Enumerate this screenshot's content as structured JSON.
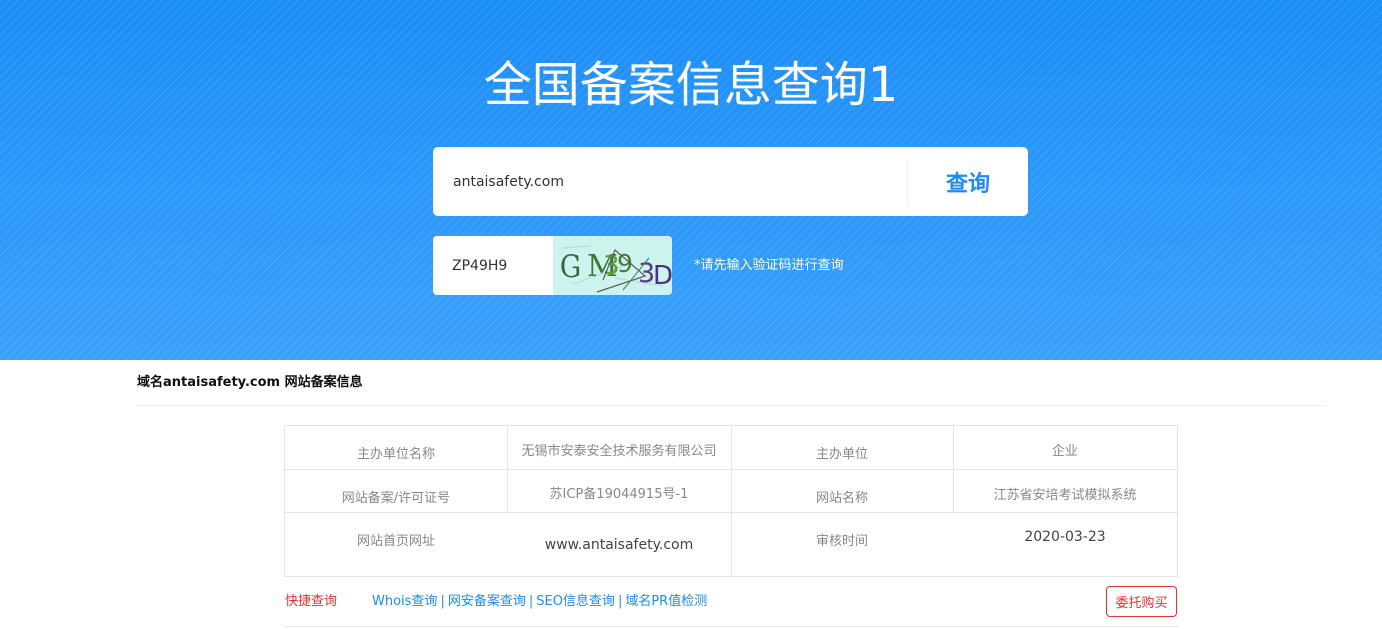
{
  "hero": {
    "title": "全国备案信息查询1",
    "search_value": "antaisafety.com",
    "search_button": "查询",
    "captcha_value": "ZP49H9",
    "captcha_image_text": "GM39 3D",
    "captcha_hint": "*请先输入验证码进行查询"
  },
  "section": {
    "title": "域名antaisafety.com 网站备案信息"
  },
  "info": {
    "rows": [
      {
        "label1": "主办单位名称",
        "value1": "无锡市安泰安全技术服务有限公司",
        "label2": "主办单位",
        "value2": "企业"
      },
      {
        "label1": "网站备案/许可证号",
        "value1": "苏ICP备19044915号-1",
        "label2": "网站名称",
        "value2": "江苏省安培考试模拟系统"
      },
      {
        "label1": "网站首页网址",
        "value1": "www.antaisafety.com",
        "label2": "审核时间",
        "value2": "2020-03-23"
      }
    ]
  },
  "quick": {
    "label": "快捷查询",
    "links": [
      "Whois查询",
      "网安备案查询",
      "SEO信息查询",
      "域名PR值检测"
    ],
    "separator": "|",
    "entrust_button": "委托购买"
  },
  "colors": {
    "hero_blue": "#2a97fa",
    "accent_blue": "#1d8cf5",
    "accent_red": "#e1332f"
  }
}
